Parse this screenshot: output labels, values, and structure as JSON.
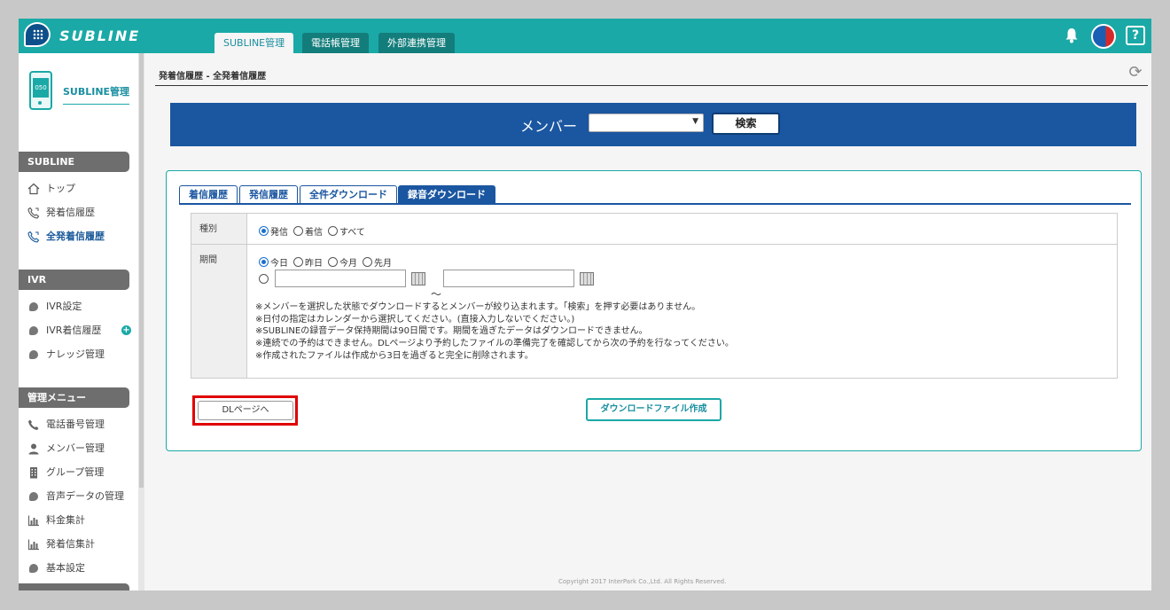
{
  "header": {
    "logo_text": "SUBLINE",
    "tabs": [
      {
        "label": "SUBLINE管理",
        "active": true
      },
      {
        "label": "電話帳管理",
        "active": false
      },
      {
        "label": "外部連携管理",
        "active": false
      }
    ],
    "help_label": "?",
    "colors": {
      "teal": "#1aa9a6",
      "blue": "#1b56a1"
    }
  },
  "sidebar": {
    "phone_label": "050",
    "title": "SUBLINE管理",
    "sections": [
      {
        "label": "SUBLINE",
        "items": [
          {
            "label": "トップ",
            "icon": "home-icon"
          },
          {
            "label": "発着信履歴",
            "icon": "phone-icon"
          },
          {
            "label": "全発着信履歴",
            "icon": "phone-icon",
            "current": true
          }
        ]
      },
      {
        "label": "IVR",
        "items": [
          {
            "label": "IVR設定",
            "icon": "bubble-icon"
          },
          {
            "label": "IVR着信履歴",
            "icon": "bubble-icon",
            "badge": "+"
          },
          {
            "label": "ナレッジ管理",
            "icon": "bubble-icon"
          }
        ]
      },
      {
        "label": "管理メニュー",
        "items": [
          {
            "label": "電話番号管理",
            "icon": "phone-icon"
          },
          {
            "label": "メンバー管理",
            "icon": "user-icon"
          },
          {
            "label": "グループ管理",
            "icon": "building-icon"
          },
          {
            "label": "音声データの管理",
            "icon": "bubble-icon"
          },
          {
            "label": "料金集計",
            "icon": "bar-chart-icon"
          },
          {
            "label": "発着信集計",
            "icon": "bar-chart-icon"
          },
          {
            "label": "基本設定",
            "icon": "bubble-icon"
          }
        ]
      }
    ]
  },
  "main": {
    "breadcrumb": "発着信履歴 - 全発着信履歴",
    "member_bar": {
      "label": "メンバー",
      "selected": "",
      "search_label": "検索"
    },
    "tabs": [
      {
        "label": "着信履歴"
      },
      {
        "label": "発信履歴"
      },
      {
        "label": "全件ダウンロード"
      },
      {
        "label": "録音ダウンロード",
        "active": true
      }
    ],
    "form": {
      "type_label": "種別",
      "type_options": [
        {
          "label": "発信",
          "checked": true
        },
        {
          "label": "着信",
          "checked": false
        },
        {
          "label": "すべて",
          "checked": false
        }
      ],
      "period_label": "期間",
      "period_options": [
        {
          "label": "今日",
          "checked": true
        },
        {
          "label": "昨日",
          "checked": false
        },
        {
          "label": "今月",
          "checked": false
        },
        {
          "label": "先月",
          "checked": false
        }
      ],
      "date_from": "",
      "date_to": "",
      "tilde": "～",
      "notes": [
        "※メンバーを選択した状態でダウンロードするとメンバーが絞り込まれます。「検索」を押す必要はありません。",
        "※日付の指定はカレンダーから選択してください。(直接入力しないでください。)",
        "※SUBLINEの録音データ保持期間は90日間です。期間を過ぎたデータはダウンロードできません。",
        "※連続での予約はできません。DLページより予約したファイルの準備完了を確認してから次の予約を行なってください。",
        "※作成されたファイルは作成から3日を過ぎると完全に削除されます。"
      ]
    },
    "dl_page_button": "DLページへ",
    "create_button": "ダウンロードファイル作成",
    "copyright": "Copyright 2017 InterPark Co.,Ltd. All Rights Reserved."
  }
}
